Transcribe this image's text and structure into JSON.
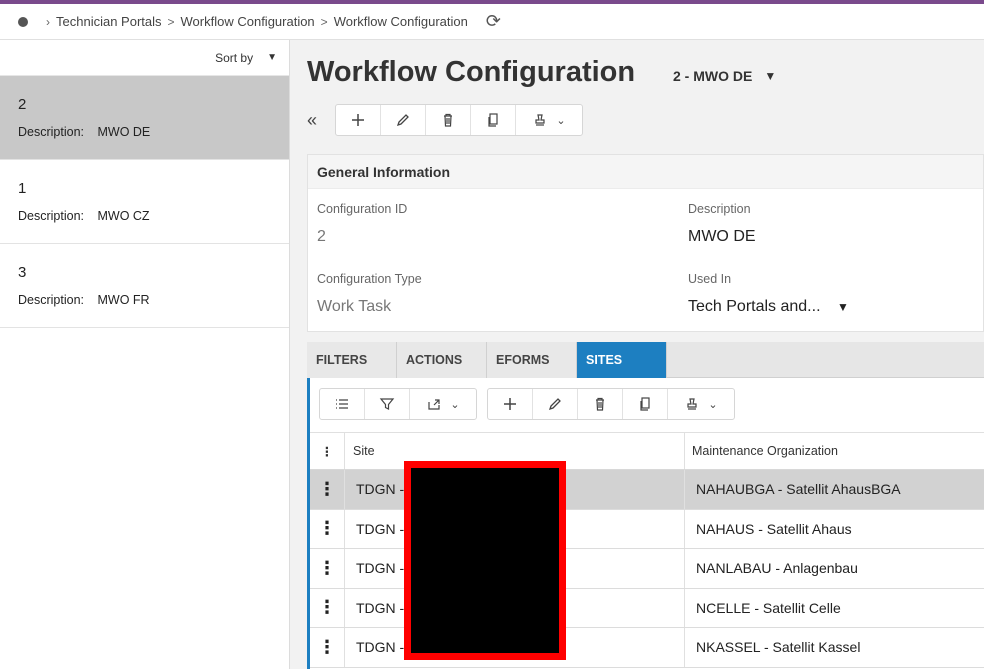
{
  "breadcrumb": {
    "items": [
      "Technician Portals",
      "Workflow Configuration",
      "Workflow Configuration"
    ]
  },
  "left_pane": {
    "sort_label": "Sort by",
    "desc_label": "Description:",
    "records": [
      {
        "id": "2",
        "description": "MWO DE"
      },
      {
        "id": "1",
        "description": "MWO CZ"
      },
      {
        "id": "3",
        "description": "MWO FR"
      }
    ]
  },
  "main": {
    "title": "Workflow Configuration",
    "record_selector": "2 - MWO DE"
  },
  "general_info": {
    "header": "General Information",
    "config_id_label": "Configuration ID",
    "config_id_value": "2",
    "description_label": "Description",
    "description_value": "MWO DE",
    "config_type_label": "Configuration Type",
    "config_type_value": "Work Task",
    "used_in_label": "Used In",
    "used_in_value": "Tech Portals and..."
  },
  "tabs": [
    "FILTERS",
    "ACTIONS",
    "EFORMS",
    "SITES"
  ],
  "grid": {
    "col_site": "Site",
    "col_org": "Maintenance Organization",
    "rows": [
      {
        "site": "TDGN -",
        "org": "NAHAUBGA - Satellit AhausBGA"
      },
      {
        "site": "TDGN -",
        "org": "NAHAUS - Satellit Ahaus"
      },
      {
        "site": "TDGN -",
        "org": "NANLABAU - Anlagenbau"
      },
      {
        "site": "TDGN -",
        "org": "NCELLE - Satellit Celle"
      },
      {
        "site": "TDGN -",
        "org": "NKASSEL - Satellit Kassel"
      }
    ]
  },
  "colors": {
    "accent": "#1d7fc1",
    "top_bar": "#7a4a8c",
    "redaction_border": "#ff0000"
  }
}
